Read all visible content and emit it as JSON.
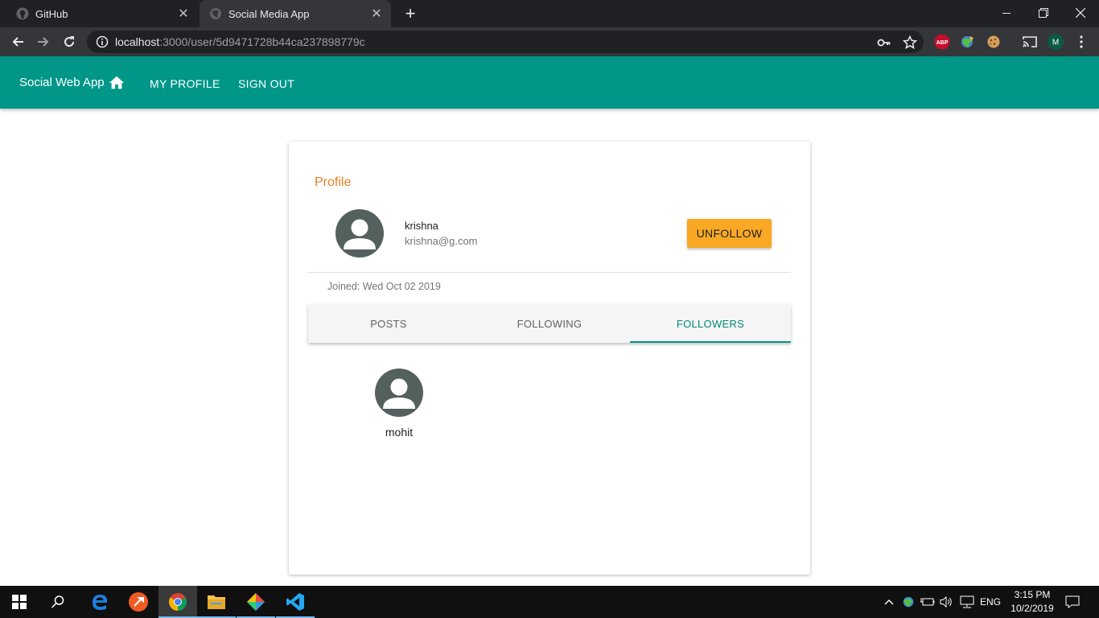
{
  "browser": {
    "tabs": [
      {
        "title": "GitHub"
      },
      {
        "title": "Social Media App"
      }
    ],
    "url_host": "localhost",
    "url_path": ":3000/user/5d9471728b44ca237898779c",
    "extensions": {
      "abp": "ABP",
      "profile_initial": "M"
    }
  },
  "appbar": {
    "title": "Social Web App",
    "links": [
      "MY PROFILE",
      "SIGN OUT"
    ]
  },
  "profile": {
    "heading": "Profile",
    "name": "krishna",
    "email": "krishna@g.com",
    "action_button": "UNFOLLOW",
    "joined": "Joined: Wed Oct 02 2019",
    "tabs": [
      "POSTS",
      "FOLLOWING",
      "FOLLOWERS"
    ],
    "active_tab": "FOLLOWERS",
    "followers": [
      {
        "name": "mohit"
      }
    ]
  },
  "taskbar": {
    "language": "ENG",
    "time": "3:15 PM",
    "date": "10/2/2019"
  },
  "colors": {
    "appbar": "#009688",
    "heading": "#e67e22",
    "action_button": "#f9a825",
    "active_tab": "#00897b",
    "avatar": "#53605e"
  }
}
